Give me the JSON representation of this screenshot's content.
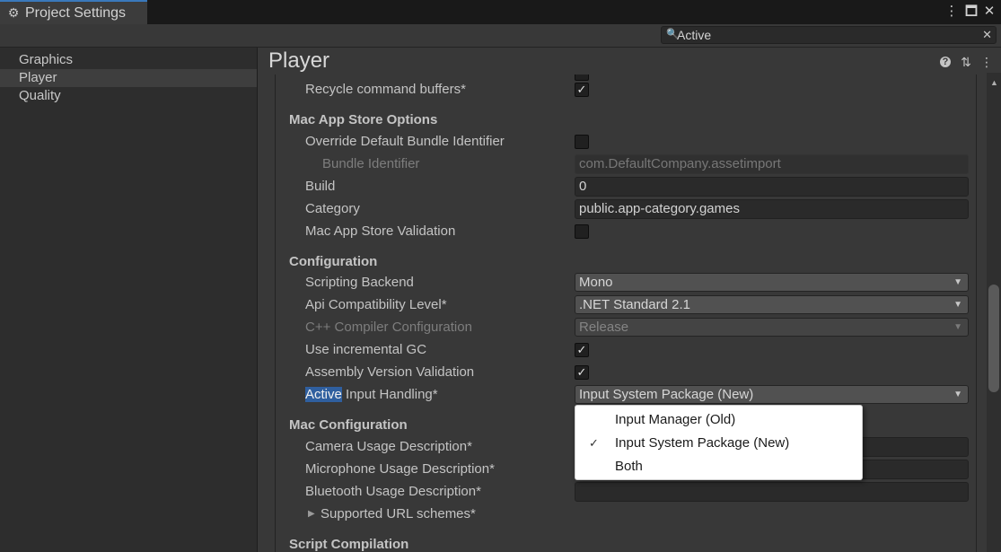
{
  "window": {
    "tab_title": "Project Settings",
    "tab_icon": "gear-icon",
    "controls": [
      "more-icon",
      "maximize-icon",
      "close-icon"
    ]
  },
  "search": {
    "value": "Active",
    "placeholder": ""
  },
  "sidebar": {
    "items": [
      {
        "label": "Graphics",
        "active": false
      },
      {
        "label": "Player",
        "active": true
      },
      {
        "label": "Quality",
        "active": false
      }
    ]
  },
  "main": {
    "title": "Player",
    "toolbar_icons": [
      "help-icon",
      "presets-icon",
      "more-icon"
    ],
    "rows": {
      "recycle": {
        "label": "Recycle command buffers*",
        "checked": true
      },
      "mac_app_store": {
        "header": "Mac App Store Options"
      },
      "override_bundle": {
        "label": "Override Default Bundle Identifier",
        "checked": false
      },
      "bundle_id": {
        "label": "Bundle Identifier",
        "value": "com.DefaultCompany.assetimport"
      },
      "build": {
        "label": "Build",
        "value": "0"
      },
      "category": {
        "label": "Category",
        "value": "public.app-category.games"
      },
      "app_store_validation": {
        "label": "Mac App Store Validation",
        "checked": false
      },
      "configuration": {
        "header": "Configuration"
      },
      "scripting_backend": {
        "label": "Scripting Backend",
        "value": "Mono"
      },
      "api_level": {
        "label": "Api Compatibility Level*",
        "value": ".NET Standard 2.1"
      },
      "cpp_compiler": {
        "label": "C++ Compiler Configuration",
        "value": "Release"
      },
      "incremental_gc": {
        "label": "Use incremental GC",
        "checked": true
      },
      "assembly_validation": {
        "label": "Assembly Version Validation",
        "checked": true
      },
      "active_input": {
        "label_highlight": "Active",
        "label_rest": " Input Handling*",
        "value": "Input System Package (New)"
      },
      "mac_config": {
        "header": "Mac Configuration"
      },
      "camera_usage": {
        "label": "Camera Usage Description*"
      },
      "microphone_usage": {
        "label": "Microphone Usage Description*"
      },
      "bluetooth_usage": {
        "label": "Bluetooth Usage Description*",
        "value": ""
      },
      "url_schemes": {
        "label": "Supported URL schemes*"
      },
      "script_compilation": {
        "header": "Script Compilation"
      }
    }
  },
  "dropdown_menu": {
    "options": [
      {
        "label": "Input Manager (Old)",
        "selected": false
      },
      {
        "label": "Input System Package (New)",
        "selected": true
      },
      {
        "label": "Both",
        "selected": false
      }
    ]
  },
  "colors": {
    "accent": "#2f5f9f",
    "tab_border": "#3a79bb",
    "panel": "#383838",
    "sidebar": "#2d2d2d"
  }
}
